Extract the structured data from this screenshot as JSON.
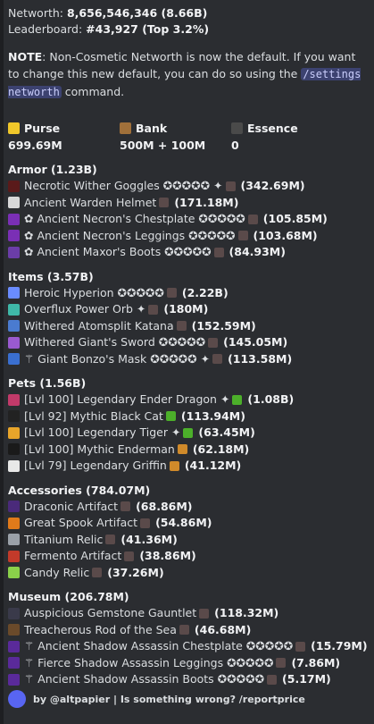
{
  "header": {
    "networth_label": "Networth:",
    "networth_value": "8,656,546,346 (8.66B)",
    "leaderboard_label": "Leaderboard:",
    "leaderboard_value": "#43,927 (Top 3.2%)"
  },
  "note": {
    "prefix": "NOTE",
    "text1": ": Non-Cosmetic Networth is now the default. If you want to change this new default, you can do so using the ",
    "command": "/settings networth",
    "text2": " command."
  },
  "stats": [
    {
      "label": "Purse",
      "value": "699.69M",
      "icon": "gold-ingot-icon",
      "color": "#f0c72a"
    },
    {
      "label": "Bank",
      "value": "500M + 100M",
      "icon": "chest-icon",
      "color": "#a0703a"
    },
    {
      "label": "Essence",
      "value": "0",
      "icon": "essence-icon",
      "color": "#4a4a4a"
    }
  ],
  "sections": [
    {
      "title": "Armor (1.23B)",
      "items": [
        {
          "text": "Necrotic Wither Goggles ✪✪✪✪✪ ✦",
          "price": "(342.69M)",
          "icon": "wither-goggles-icon",
          "color": "#5a1a1a"
        },
        {
          "text": "Ancient Warden Helmet",
          "price": "(171.18M)",
          "icon": "warden-helmet-icon",
          "color": "#d8d8d8"
        },
        {
          "text": "✿ Ancient Necron's Chestplate ✪✪✪✪✪",
          "price": "(105.85M)",
          "icon": "necron-chestplate-icon",
          "color": "#7a2fb5"
        },
        {
          "text": "✿ Ancient Necron's Leggings ✪✪✪✪✪",
          "price": "(103.68M)",
          "icon": "necron-leggings-icon",
          "color": "#7a2fb5"
        },
        {
          "text": "✿ Ancient Maxor's Boots ✪✪✪✪✪",
          "price": "(84.93M)",
          "icon": "maxor-boots-icon",
          "color": "#6b3da8"
        }
      ]
    },
    {
      "title": "Items (3.57B)",
      "items": [
        {
          "text": "Heroic Hyperion ✪✪✪✪✪",
          "price": "(2.22B)",
          "icon": "hyperion-icon",
          "color": "#6a8cff"
        },
        {
          "text": "Overflux Power Orb ✦",
          "price": "(180M)",
          "icon": "power-orb-icon",
          "color": "#3fb8a8"
        },
        {
          "text": "Withered Atomsplit Katana",
          "price": "(152.59M)",
          "icon": "katana-icon",
          "color": "#4a7bd0"
        },
        {
          "text": "Withered Giant's Sword ✪✪✪✪✪",
          "price": "(145.05M)",
          "icon": "giant-sword-icon",
          "color": "#9a5ad0"
        },
        {
          "text": "⚚ Giant Bonzo's Mask ✪✪✪✪✪ ✦",
          "price": "(113.58M)",
          "icon": "bonzo-mask-icon",
          "color": "#3a6fd0"
        }
      ]
    },
    {
      "title": "Pets (1.56B)",
      "items": [
        {
          "text": "[Lvl 100] Legendary Ender Dragon ✦",
          "price": "(1.08B)",
          "icon": "ender-dragon-icon",
          "color": "#c23a6a",
          "badge": "green-cube-icon"
        },
        {
          "text": "[Lvl 92] Mythic Black Cat",
          "price": "(113.94M)",
          "icon": "black-cat-icon",
          "color": "#222222",
          "badge": "green-cube-icon"
        },
        {
          "text": "[Lvl 100] Legendary Tiger ✦",
          "price": "(63.45M)",
          "icon": "tiger-icon",
          "color": "#e8a52a",
          "badge": "green-cube-icon"
        },
        {
          "text": "[Lvl 100] Mythic Enderman",
          "price": "(62.18M)",
          "icon": "enderman-icon",
          "color": "#1a1a1a",
          "badge": "orange-orb-icon"
        },
        {
          "text": "[Lvl 79] Legendary Griffin",
          "price": "(41.12M)",
          "icon": "griffin-icon",
          "color": "#e8e8e8",
          "badge": "orange-orb-icon"
        }
      ]
    },
    {
      "title": "Accessories (784.07M)",
      "items": [
        {
          "text": "Draconic Artifact",
          "price": "(68.86M)",
          "icon": "draconic-artifact-icon",
          "color": "#4a2a7a"
        },
        {
          "text": "Great Spook Artifact",
          "price": "(54.86M)",
          "icon": "spook-artifact-icon",
          "color": "#e07a1a"
        },
        {
          "text": "Titanium Relic",
          "price": "(41.36M)",
          "icon": "titanium-relic-icon",
          "color": "#9aa0a8"
        },
        {
          "text": "Fermento Artifact",
          "price": "(38.86M)",
          "icon": "fermento-artifact-icon",
          "color": "#c23a2a"
        },
        {
          "text": "Candy Relic",
          "price": "(37.26M)",
          "icon": "candy-relic-icon",
          "color": "#8ad04a"
        }
      ]
    },
    {
      "title": "Museum (206.78M)",
      "items": [
        {
          "text": "Auspicious Gemstone Gauntlet",
          "price": "(118.32M)",
          "icon": "gauntlet-icon",
          "color": "#3a3a4a"
        },
        {
          "text": "Treacherous Rod of the Sea",
          "price": "(46.68M)",
          "icon": "fishing-rod-icon",
          "color": "#6a4a2a"
        },
        {
          "text": "⚚ Ancient Shadow Assassin Chestplate ✪✪✪✪✪",
          "price": "(15.79M)",
          "icon": "shadow-chestplate-icon",
          "color": "#5a2a9a"
        },
        {
          "text": "⚚ Fierce Shadow Assassin Leggings ✪✪✪✪✪",
          "price": "(7.86M)",
          "icon": "shadow-leggings-icon",
          "color": "#5a2a9a"
        },
        {
          "text": "⚚ Ancient Shadow Assassin Boots ✪✪✪✪✪",
          "price": "(5.17M)",
          "icon": "shadow-boots-icon",
          "color": "#5a2a9a"
        }
      ]
    }
  ],
  "footer": {
    "text": "by @altpapier | Is something wrong? /reportprice"
  },
  "colors": {
    "background": "#2b2d31",
    "command_bg": "#3c4270",
    "chest_badge": "#5a4a4a"
  }
}
